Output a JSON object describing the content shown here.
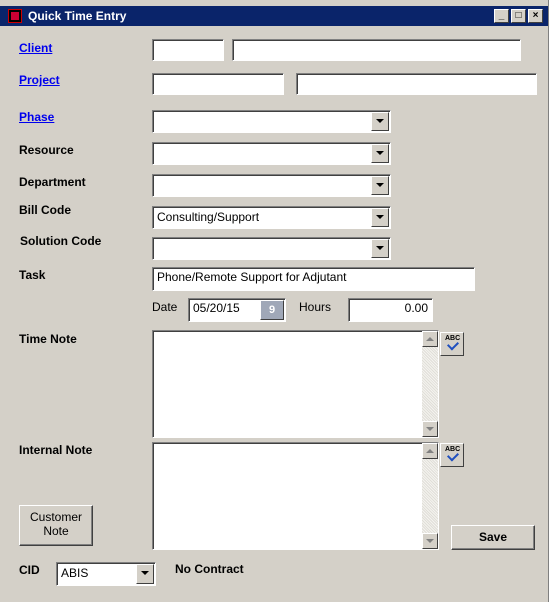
{
  "window": {
    "title": "Quick Time Entry"
  },
  "form": {
    "client": {
      "label": "Client",
      "code": "",
      "name": ""
    },
    "project": {
      "label": "Project",
      "code": "",
      "name": ""
    },
    "phase": {
      "label": "Phase",
      "value": ""
    },
    "resource": {
      "label": "Resource",
      "value": ""
    },
    "department": {
      "label": "Department",
      "value": ""
    },
    "bill_code": {
      "label": "Bill Code",
      "value": "Consulting/Support"
    },
    "solution_code": {
      "label": "Solution Code",
      "value": ""
    },
    "task": {
      "label": "Task",
      "value": "Phone/Remote Support for Adjutant"
    },
    "date": {
      "label": "Date",
      "value": "05/20/15",
      "calendar_glyph": "9"
    },
    "hours": {
      "label": "Hours",
      "value": "0.00"
    },
    "time_note": {
      "label": "Time Note",
      "value": ""
    },
    "internal_note": {
      "label": "Internal Note",
      "value": ""
    },
    "spell_abc": "ABC",
    "customer_note_button": "Customer\nNote",
    "save_button": "Save",
    "cid": {
      "label": "CID",
      "value": "ABIS"
    },
    "contract_status": "No Contract"
  },
  "icons": {
    "app": "app-icon",
    "minimize": "minimize-icon",
    "maximize": "maximize-icon",
    "close": "close-icon"
  }
}
